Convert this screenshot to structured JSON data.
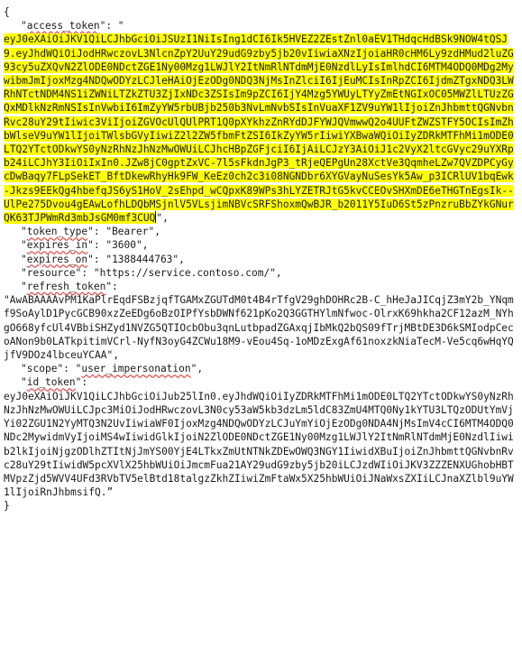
{
  "json_doc": {
    "open_brace": "{",
    "close_brace": "}",
    "access_token_key": "access_token",
    "access_token_value": "eyJ0eXAiOiJKV1QiLCJhbGciOiJSUzI1NiIsIng1dCI6Ik5HVEZ2ZEstZnl0aEV1THdqcHdBSk9NOW4tQSJ9.eyJhdWQiOiJodHRwczovL3NlcnZpY2UuY29udG9zby5jb20vIiwiaXNzIjoiaHR0cHM6Ly9zdHMud2luZG93cy5uZXQvN2ZlODE0NDctZGE1Ny00Mzg1LWJlY2ItNmRlNTdmMjE0NzdlLyIsImlhdCI6MTM4ODQ0MDg2MywibmJmIjoxMzg4NDQwODYzLCJleHAiOjEzODg0NDQ3NjMsInZlciI6IjEuMCIsInRpZCI6IjdmZTgxNDQ3LWRhNTctNDM4NS1iZWNiLTZkZTU3ZjIxNDc3ZSIsIm9pZCI6IjY4Mzg5YWUyLTYyZmEtNGIxOC05MWZlLTUzZGQxMDlkNzRmNSIsInVwbiI6ImZyYW5rbUBjb250b3NvLmNvbSIsInVuaXF1ZV9uYW1lIjoiZnJhbmttQGNvbnRvc28uY29tIiwic3ViIjoiZGVOcUlQUlPRT1Q0pXYkhzZnRYdDJFYWJQVmwwQ2o4UUFtZWZSTFY5OCIsImZhbWlseV9uYW1lIjoiTWlsbGVyIiwiZ2l2ZW5fbmFtZSI6IkZyYW5rIiwiYXBwaWQiOiIyZDRkMTFhMi1mODE0LTQ2YTctODkwYS0yNzRhNzJhNzMwOWUiLCJhcHBpZGFjciI6IjAiLCJzY3AiOiJ1c2VyX2ltcGVyc29uYXRpb24iLCJhY3IiOiIxIn0.JZw8jC0gptZxVC-7l5sFkdnJgP3_tRjeQEPgUn28XctVe3QqmheLZw7QVZDPCyGycDwBaqy7FLpSekET_BftDkewRhyHk9FW_KeEz0ch2c3i08NGNDbr6XYGVayNuSesYk5Aw_p3ICRlUV1bqEwk-Jkzs9EEkQg4hbefqJS6yS1HoV_2sEhpd_wCQpxK89WPs3hLYZETRJtG5kvCCEOvSHXmDE6eTHGTnEgsIk--UlPe275Dvou4gEAwLofhLDQbMSjnlV5VLsjimNBVcSRFShoxmQwBJR_b2011Y5IuD6St5zPnzruBbZYkGNurQK63TJPWmRd3mbJsGM0mf3CUQ",
    "token_type_key": "token_type",
    "token_type_value": "Bearer",
    "expires_in_key": "expires_in",
    "expires_in_value": "3600",
    "expires_on_key": "expires_on",
    "expires_on_value": "1388444763",
    "resource_key": "resource",
    "resource_value": "https://service.contoso.com/",
    "refresh_token_key": "refresh_token",
    "refresh_token_value": "AwABAAAAvPM1KaPlrEqdFSBzjqfTGAMxZGUTdM0t4B4rTfgV29ghDOHRc2B-C_hHeJaJICqjZ3mY2b_YNqmf9SoAylD1PycGCB90xzZeEDg6oBzOIPfYsbDWNf621pKo2Q3GGTHYlmNfwoc-OlrxK69hkha2CF12azM_NYhgO668yfcUl4VBbiSHZyd1NVZG5QTIOcbObu3qnLutbpadZGAxqjIbMkQ2bQS09fTrjMBtDE3D6kSMIodpCecoANon9b0LATkpitimVCrl-NyfN3oyG4ZCWu18M9-vEou4Sq-1oMDzExgAf61noxzkNiaTecM-Ve5cq6wHqYQjfV9DOz4lbceuYCAA",
    "scope_key": "scope",
    "scope_value": "user_impersonation",
    "id_token_key": "id_token",
    "id_token_value": "eyJ0eXAiOiJKV1QiLCJhbGciOiJub25lIn0.eyJhdWQiOiIyZDRkMTFhMi1mODE0LTQ2YTctODkwYS0yNzRhNzJhNzMwOWUiLCJpc3MiOiJodHRwczovL3N0cy53aW5kb3dzLm5ldC83ZmU4MTQ0Ny1kYTU3LTQzODUtYmVjYi02ZGU1N2YyMTQ3N2UvIiwiaWF0IjoxMzg4NDQwODYzLCJuYmYiOjEzODg0NDA4NjMsImV4cCI6MTM4ODQ0NDc2MywidmVyIjoiMS4wIiwidGlkIjoiN2ZlODE0NDctZGE1Ny00Mzg1LWJlY2ItNmRlNTdmMjE0NzdlIiwib2lkIjoiNjgzODlhZTItNjJmYS00YjE4LTkxZmUtNTNkZDEwOWQ3NGY1IiwidXBuIjoiZnJhbmttQGNvbnRvc28uY29tIiwidW5pcXVlX25hbWUiOiJmcmFua21AY29udG9zby5jb20iLCJzdWIiOiJKV3ZZZENXUGhobHBTMVpzZjd5WVV4UFd3RVbTV5elBtd18talgzZkhZIiwiZmFtaWx5X25hbWUiOiJNaWxsZXIiLCJnaXZlbl9uYW1lIjoiRnJhbmsifQ.”"
  }
}
